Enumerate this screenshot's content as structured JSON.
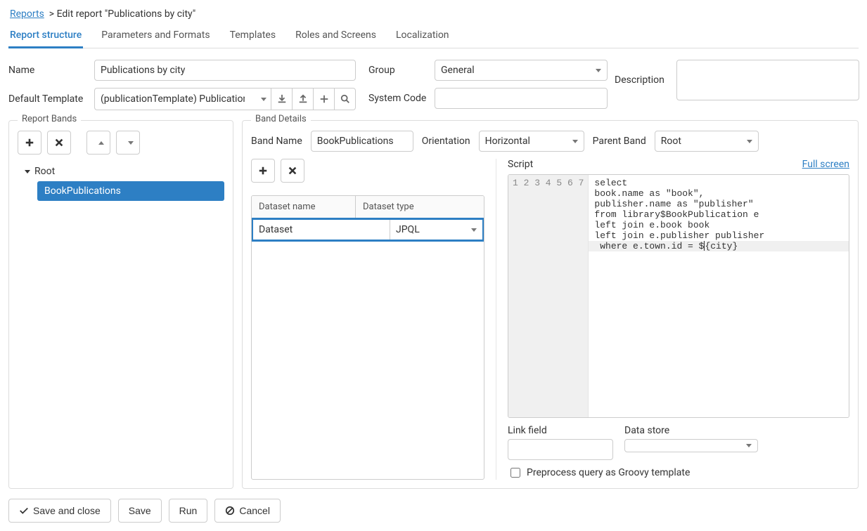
{
  "breadcrumb": {
    "reports_link": "Reports",
    "sep": ">",
    "title": "Edit report \"Publications by city\""
  },
  "tabs": {
    "structure": "Report structure",
    "params": "Parameters and Formats",
    "templates": "Templates",
    "roles": "Roles and Screens",
    "localization": "Localization"
  },
  "top": {
    "name_label": "Name",
    "name_value": "Publications by city",
    "group_label": "Group",
    "group_value": "General",
    "description_label": "Description",
    "description_value": "",
    "default_template_label": "Default Template",
    "default_template_value": "(publicationTemplate) Publication",
    "system_code_label": "System Code",
    "system_code_value": ""
  },
  "bands": {
    "legend": "Report Bands",
    "root": "Root",
    "child": "BookPublications"
  },
  "details": {
    "legend": "Band Details",
    "band_name_label": "Band Name",
    "band_name_value": "BookPublications",
    "orientation_label": "Orientation",
    "orientation_value": "Horizontal",
    "parent_label": "Parent Band",
    "parent_value": "Root",
    "dataset_name_header": "Dataset name",
    "dataset_type_header": "Dataset type",
    "dataset_name_value": "Dataset",
    "dataset_type_value": "JPQL",
    "script_label": "Script",
    "full_screen": "Full screen",
    "script_lines": [
      "select",
      "book.name as \"book\",",
      "publisher.name as \"publisher\"",
      "from library$BookPublication e",
      "left join e.book book",
      "left join e.publisher publisher",
      " where e.town.id = ${city}"
    ],
    "link_field_label": "Link field",
    "link_field_value": "",
    "data_store_label": "Data store",
    "data_store_value": "",
    "preprocess_label": "Preprocess query as Groovy template"
  },
  "footer": {
    "save_close": "Save and close",
    "save": "Save",
    "run": "Run",
    "cancel": "Cancel"
  }
}
